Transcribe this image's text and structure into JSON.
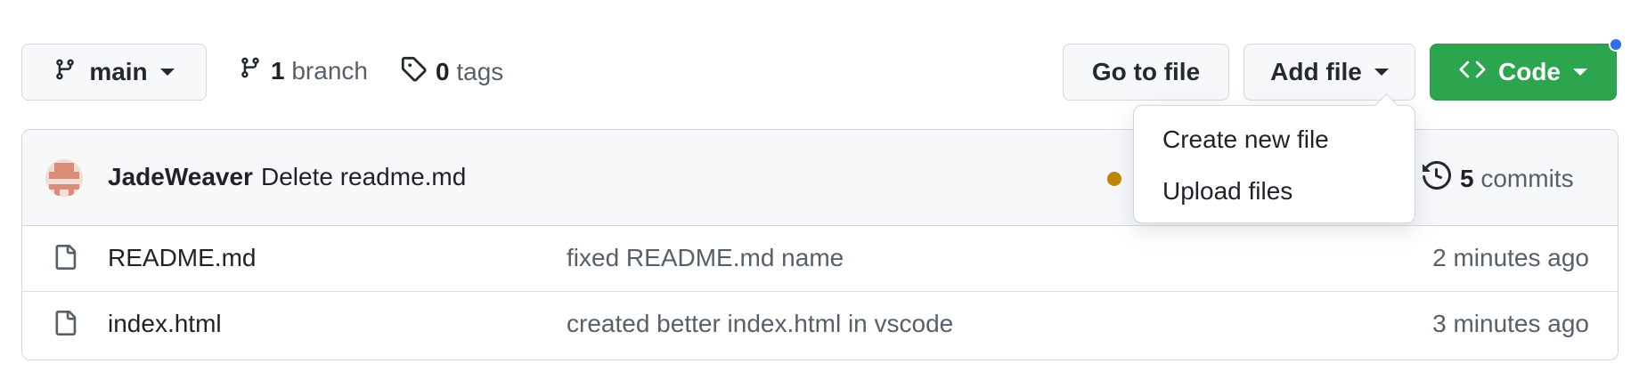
{
  "toolbar": {
    "branch_selector": "main",
    "branch_count": "1",
    "branch_label": "branch",
    "tag_count": "0",
    "tag_label": "tags",
    "go_to_file": "Go to file",
    "add_file": "Add file",
    "code": "Code"
  },
  "add_file_menu": {
    "items": [
      "Create new file",
      "Upload files"
    ]
  },
  "latest_commit": {
    "author": "JadeWeaver",
    "message": "Delete readme.md",
    "commits_count": "5",
    "commits_label": "commits",
    "status_color": "#bf8700"
  },
  "files": [
    {
      "name": "README.md",
      "message": "fixed README.md name",
      "time": "2 minutes ago"
    },
    {
      "name": "index.html",
      "message": "created better index.html in vscode",
      "time": "3 minutes ago"
    }
  ],
  "colors": {
    "code_button": "#2da44e",
    "notification_dot": "#2f6feb"
  }
}
